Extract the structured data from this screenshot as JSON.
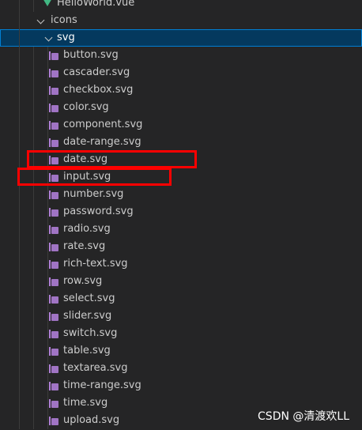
{
  "explorer": {
    "items": [
      {
        "label": "HelloWorld.vue",
        "icon": "vue-icon"
      },
      {
        "label": "icons",
        "icon": "chevron-down-icon"
      },
      {
        "label": "svg",
        "icon": "chevron-down-icon"
      },
      {
        "label": "button.svg",
        "icon": "svg-file-icon"
      },
      {
        "label": "cascader.svg",
        "icon": "svg-file-icon"
      },
      {
        "label": "checkbox.svg",
        "icon": "svg-file-icon"
      },
      {
        "label": "color.svg",
        "icon": "svg-file-icon"
      },
      {
        "label": "component.svg",
        "icon": "svg-file-icon"
      },
      {
        "label": "date-range.svg",
        "icon": "svg-file-icon"
      },
      {
        "label": "date.svg",
        "icon": "svg-file-icon"
      },
      {
        "label": "input.svg",
        "icon": "svg-file-icon"
      },
      {
        "label": "number.svg",
        "icon": "svg-file-icon"
      },
      {
        "label": "password.svg",
        "icon": "svg-file-icon"
      },
      {
        "label": "radio.svg",
        "icon": "svg-file-icon"
      },
      {
        "label": "rate.svg",
        "icon": "svg-file-icon"
      },
      {
        "label": "rich-text.svg",
        "icon": "svg-file-icon"
      },
      {
        "label": "row.svg",
        "icon": "svg-file-icon"
      },
      {
        "label": "select.svg",
        "icon": "svg-file-icon"
      },
      {
        "label": "slider.svg",
        "icon": "svg-file-icon"
      },
      {
        "label": "switch.svg",
        "icon": "svg-file-icon"
      },
      {
        "label": "table.svg",
        "icon": "svg-file-icon"
      },
      {
        "label": "textarea.svg",
        "icon": "svg-file-icon"
      },
      {
        "label": "time-range.svg",
        "icon": "svg-file-icon"
      },
      {
        "label": "time.svg",
        "icon": "svg-file-icon"
      },
      {
        "label": "upload.svg",
        "icon": "svg-file-icon"
      }
    ]
  },
  "watermark": "CSDN @清渡欢LL",
  "colors": {
    "background": "#252526",
    "selection": "#04395e",
    "selection_border": "#007fd4",
    "svg_icon": "#a074c4",
    "vue_icon": "#41b883",
    "highlight_box": "#ff0000"
  }
}
